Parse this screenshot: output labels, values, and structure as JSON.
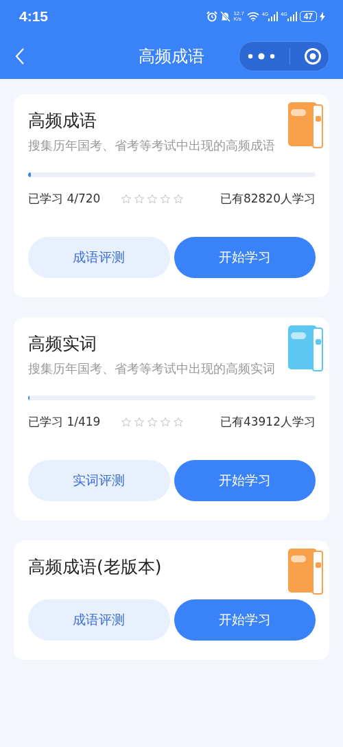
{
  "status_bar": {
    "time": "4:15",
    "net_speed": "12.7",
    "net_unit": "K/s",
    "signal_labels": [
      "4G",
      "4G"
    ],
    "battery": "47"
  },
  "nav": {
    "title": "高频成语"
  },
  "cards": [
    {
      "title": "高频成语",
      "subtitle": "搜集历年国考、省考等考试中出现的高频成语",
      "color": "#f9a04a",
      "progress": {
        "level": 0.01,
        "learned": "已学习 4/720",
        "stars": 0,
        "learners": "已有82820人学习"
      },
      "buttons": [
        {
          "label": "成语评测",
          "kind": "secondary"
        },
        {
          "label": "开始学习",
          "kind": "primary"
        }
      ]
    },
    {
      "title": "高频实词",
      "subtitle": "搜集历年国考、省考等考试中出现的高频实词",
      "color": "#5cc8f2",
      "progress": {
        "level": 0.005,
        "learned": "已学习 1/419",
        "stars": 0,
        "learners": "已有43912人学习"
      },
      "buttons": [
        {
          "label": "实词评测",
          "kind": "secondary"
        },
        {
          "label": "开始学习",
          "kind": "primary"
        }
      ]
    },
    {
      "title": "高频成语(老版本)",
      "color": "#f9a04a",
      "buttons": [
        {
          "label": "成语评测",
          "kind": "secondary"
        },
        {
          "label": "开始学习",
          "kind": "primary"
        }
      ]
    }
  ]
}
